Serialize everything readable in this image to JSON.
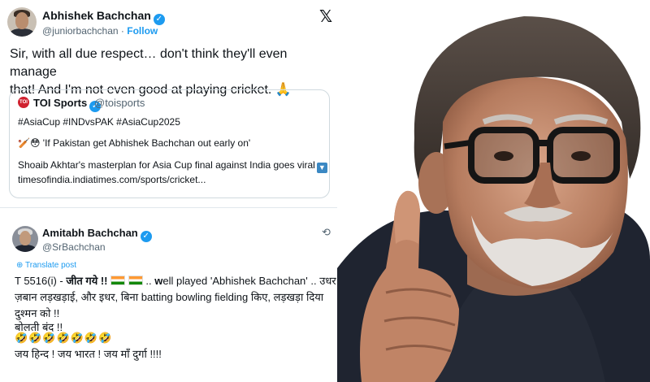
{
  "tweet1": {
    "author_name": "Abhishek Bachchan",
    "author_handle": "@juniorbachchan",
    "separator": "·",
    "follow_label": "Follow",
    "x_logo": "𝕏",
    "text_line1": "Sir, with all due respect… don't think they'll even manage",
    "text_line2": "that! And I'm not even good at playing cricket. 🙏"
  },
  "quote": {
    "logo_text": "TOI",
    "name": "TOI Sports",
    "handle": "@toisports",
    "hashtags": "#AsiaCup #INDvsPAK #AsiaCup2025",
    "line2": "🏏😳 'If Pakistan get Abhishek Bachchan out early on'",
    "line3": "Shoaib Akhtar's masterplan for Asia Cup final against India goes viral",
    "line3_icon": "▼",
    "link": "timesofindia.indiatimes.com/sports/cricket..."
  },
  "tweet2": {
    "author_name": "Amitabh Bachchan",
    "author_handle": "@SrBachchan",
    "repost_icon": "⟲",
    "translate_label": "Translate post",
    "line1_prefix": "T 5516(i) - ",
    "line1_bold": "जीत गये !!",
    "line1_mid": " .. ",
    "line1_w": "w",
    "line1_suffix": "ell played 'Abhishek Bachchan'  .. उधर",
    "line2": "ज़बान लड़खड़ाई, और इधर, बिना batting bowling fielding किए, लड़खड़ा दिया",
    "line3": "दुश्मन को  !!",
    "line4": "बोलती बंद  !!",
    "emojis": "🤣🤣🤣🤣🤣🤣🤣",
    "line6": "जय हिन्द ! जय भारत ! जय माँ दुर्गा !!!!"
  },
  "colors": {
    "verified_blue": "#1d9bf0",
    "text": "#0f1419",
    "muted": "#536471",
    "toi_red": "#d0212f"
  }
}
